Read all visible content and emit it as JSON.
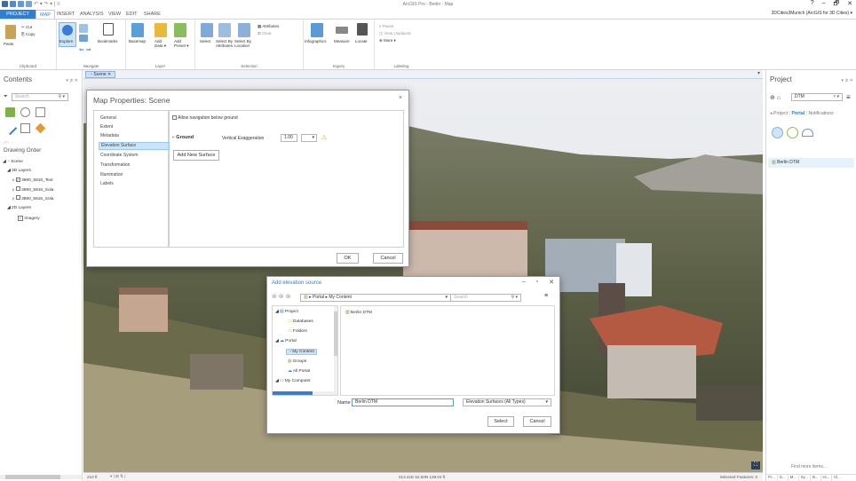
{
  "window": {
    "title": "ArcGIS Pro - Berlin - Map",
    "signin": "3DCities3Munich (ArcGIS for 3D Cities) ▾",
    "controls": [
      "?",
      "–",
      "🗗",
      "✕"
    ]
  },
  "ribbon": {
    "tabs": [
      "PROJECT",
      "MAP",
      "INSERT",
      "ANALYSIS",
      "VIEW",
      "EDIT",
      "SHARE"
    ],
    "groups": {
      "clipboard": {
        "label": "Clipboard",
        "paste": "Paste",
        "cut": "Cut",
        "copy": "Copy"
      },
      "navigate": {
        "label": "Navigate",
        "explore": "Explore",
        "bookmarks": "Bookmarks"
      },
      "layer": {
        "label": "Layer",
        "basemap": "Basemap",
        "add_data": "Add\nData ▾",
        "add_preset": "Add\nPreset ▾"
      },
      "selection": {
        "label": "Selection",
        "select": "Select",
        "select_by_attributes": "Select By\nAttributes",
        "select_by_location": "Select By\nLocation",
        "attributes": "Attributes",
        "clear": "Clear"
      },
      "inquiry": {
        "label": "Inquiry",
        "infographics": "Infographics",
        "measure": "Measure",
        "locate": "Locate"
      },
      "labeling": {
        "label": "Labeling",
        "pause": "Pause",
        "view_unplaced": "View Unplaced",
        "more": "More ▾"
      }
    }
  },
  "contents": {
    "title": "Contents",
    "pin": "▾ ⊅ ✕",
    "search_placeholder": "Search",
    "drawing_order": "Drawing Order",
    "tree": [
      "Scene",
      "3D Layers",
      "3890_5816_Text",
      "3890_5816_Sola",
      "3890_5816_Sola",
      "2D Layers",
      "Imagery"
    ]
  },
  "map": {
    "tab_label": "Scene ✕",
    "scale": "210 ft",
    "coords": "013.41E 52.50N  138.04 ft",
    "selected_features": "Selected Features: 0"
  },
  "map_properties": {
    "title": "Map Properties: Scene",
    "nav": [
      "General",
      "Extent",
      "Metadata",
      "Elevation Surface",
      "Coordinate System",
      "Transformation",
      "Illumination",
      "Labels"
    ],
    "selected_nav": "Elevation Surface",
    "allow_nav_label": "Allow navigation below ground",
    "ground_label": "Ground",
    "vertical_exaggeration_label": "Vertical Exaggeration",
    "vertical_exaggeration_value": "1.00",
    "add_surface_button": "Add New Surface",
    "ok": "OK",
    "cancel": "Cancel"
  },
  "add_elevation": {
    "title": "Add elevation source",
    "path": "▸ Portal  ▸  My Content",
    "search_placeholder": "Search",
    "tree": [
      "Project",
      "Databases",
      "Folders",
      "Portal",
      "My Content",
      "Groups",
      "All Portal",
      "My Computer"
    ],
    "items": [
      "Berlin DTM"
    ],
    "name_label": "Name",
    "name_value": "Berlin DTM",
    "filter": "Elevation Surfaces (All Types)",
    "select": "Select",
    "cancel": "Cancel"
  },
  "project_pane": {
    "title": "Project",
    "pin": "▾ ⊅ ✕",
    "search_value": "DTM",
    "tabs": [
      "Project",
      "Portal",
      "Notifications"
    ],
    "results": [
      "Berlin DTM"
    ],
    "find_more": "Find more items...",
    "bottom_tabs": [
      "Pr...",
      "G...",
      "M...",
      "Sy...",
      "B...",
      "Hi...",
      "Cl..."
    ]
  }
}
